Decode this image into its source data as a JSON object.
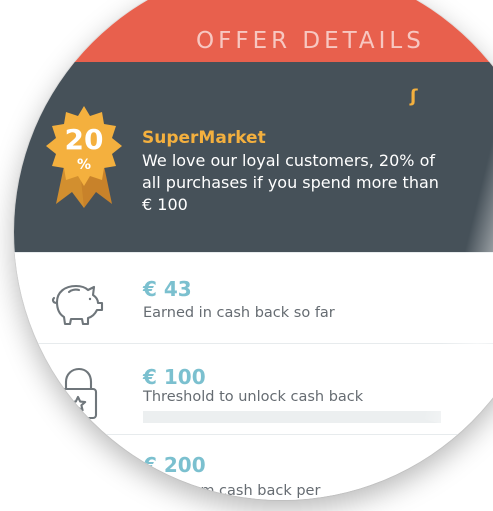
{
  "header": {
    "title": "OFFER DETAILS"
  },
  "offer": {
    "badge": {
      "value": "20",
      "suffix": "%"
    },
    "store_name": "SuperMarket",
    "description": "We love our loyal customers, 20% of\nall purchases if you spend more than\n€ 100"
  },
  "stats": [
    {
      "value": "€ 43",
      "caption": "Earned in cash back so far",
      "icon": "piggy-bank-icon"
    },
    {
      "value": "€ 100",
      "caption": "Threshold to unlock cash back",
      "icon": "lock-star-icon",
      "progress": 0
    },
    {
      "value": "€ 200",
      "caption": "Maximum cash back per",
      "icon": "wallet-icon"
    }
  ],
  "colors": {
    "accent": "#f4b03e",
    "header": "#e8604d",
    "panel": "#465159",
    "value": "#7bc0cf"
  }
}
